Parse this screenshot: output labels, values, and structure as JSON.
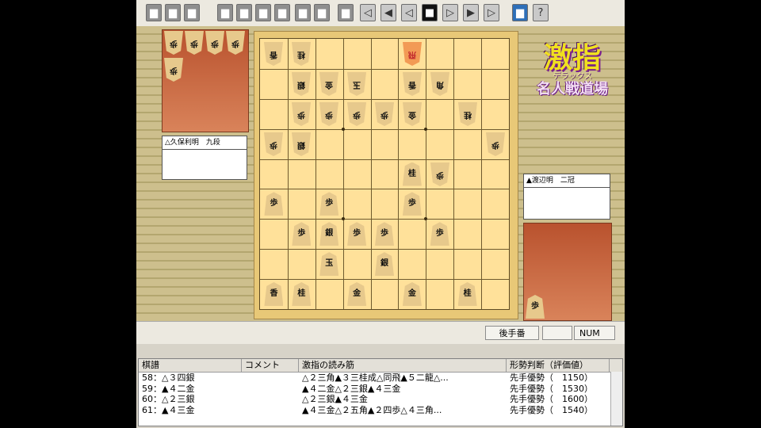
{
  "toolbar": {
    "buttons": [
      {
        "name": "new-icon",
        "glyph": "▆"
      },
      {
        "name": "open-icon",
        "glyph": "▆"
      },
      {
        "name": "save-icon",
        "glyph": "▆"
      },
      {
        "name": "copy-icon",
        "glyph": "▆"
      },
      {
        "name": "paste-icon",
        "glyph": "▆"
      },
      {
        "name": "print-icon",
        "glyph": "▆"
      },
      {
        "name": "edit-icon",
        "glyph": "▆"
      },
      {
        "name": "setup-icon",
        "glyph": "▆"
      },
      {
        "name": "think-icon",
        "glyph": "▆"
      },
      {
        "name": "hint-icon",
        "glyph": "▆"
      },
      {
        "name": "rewind-start-icon",
        "glyph": "◁"
      },
      {
        "name": "step-back-icon",
        "glyph": "◀"
      },
      {
        "name": "back-icon",
        "glyph": "◁"
      },
      {
        "name": "stop-icon",
        "glyph": "■"
      },
      {
        "name": "forward-icon",
        "glyph": "▷"
      },
      {
        "name": "step-forward-icon",
        "glyph": "▶"
      },
      {
        "name": "forward-end-icon",
        "glyph": "▷"
      },
      {
        "name": "display-icon",
        "glyph": "▆"
      },
      {
        "name": "help-icon",
        "glyph": "?"
      }
    ]
  },
  "logo": {
    "main": "激指",
    "sub1": "デラックス",
    "sub2": "名人戦道場"
  },
  "players": {
    "gote_name": "△久保利明　九段",
    "sente_name": "▲渡辺明　二冠"
  },
  "hand": {
    "gote": [
      "歩",
      "歩",
      "歩",
      "歩",
      "歩"
    ],
    "sente": [
      "歩"
    ]
  },
  "board": {
    "pieces": [
      {
        "f": 9,
        "r": 1,
        "t": "香",
        "o": "g"
      },
      {
        "f": 8,
        "r": 1,
        "t": "桂",
        "o": "g"
      },
      {
        "f": 4,
        "r": 1,
        "t": "飛",
        "o": "g",
        "hl": true
      },
      {
        "f": 8,
        "r": 2,
        "t": "銀",
        "o": "g"
      },
      {
        "f": 7,
        "r": 2,
        "t": "金",
        "o": "g"
      },
      {
        "f": 6,
        "r": 2,
        "t": "玉",
        "o": "g"
      },
      {
        "f": 4,
        "r": 2,
        "t": "香",
        "o": "g"
      },
      {
        "f": 3,
        "r": 2,
        "t": "角",
        "o": "g"
      },
      {
        "f": 8,
        "r": 3,
        "t": "歩",
        "o": "g"
      },
      {
        "f": 7,
        "r": 3,
        "t": "歩",
        "o": "g"
      },
      {
        "f": 6,
        "r": 3,
        "t": "歩",
        "o": "g"
      },
      {
        "f": 5,
        "r": 3,
        "t": "歩",
        "o": "g"
      },
      {
        "f": 4,
        "r": 3,
        "t": "金",
        "o": "g"
      },
      {
        "f": 2,
        "r": 3,
        "t": "桂",
        "o": "g"
      },
      {
        "f": 9,
        "r": 4,
        "t": "歩",
        "o": "g"
      },
      {
        "f": 8,
        "r": 4,
        "t": "銀",
        "o": "g"
      },
      {
        "f": 1,
        "r": 4,
        "t": "歩",
        "o": "g"
      },
      {
        "f": 4,
        "r": 5,
        "t": "桂",
        "o": "s"
      },
      {
        "f": 3,
        "r": 5,
        "t": "歩",
        "o": "g"
      },
      {
        "f": 9,
        "r": 6,
        "t": "歩",
        "o": "s"
      },
      {
        "f": 7,
        "r": 6,
        "t": "歩",
        "o": "s"
      },
      {
        "f": 4,
        "r": 6,
        "t": "歩",
        "o": "s"
      },
      {
        "f": 8,
        "r": 7,
        "t": "歩",
        "o": "s"
      },
      {
        "f": 7,
        "r": 7,
        "t": "銀",
        "o": "s"
      },
      {
        "f": 6,
        "r": 7,
        "t": "歩",
        "o": "s"
      },
      {
        "f": 5,
        "r": 7,
        "t": "歩",
        "o": "s"
      },
      {
        "f": 3,
        "r": 7,
        "t": "歩",
        "o": "s"
      },
      {
        "f": 7,
        "r": 8,
        "t": "玉",
        "o": "s"
      },
      {
        "f": 5,
        "r": 8,
        "t": "銀",
        "o": "s"
      },
      {
        "f": 9,
        "r": 9,
        "t": "香",
        "o": "s"
      },
      {
        "f": 8,
        "r": 9,
        "t": "桂",
        "o": "s"
      },
      {
        "f": 6,
        "r": 9,
        "t": "金",
        "o": "s"
      },
      {
        "f": 4,
        "r": 9,
        "t": "金",
        "o": "s"
      },
      {
        "f": 2,
        "r": 9,
        "t": "桂",
        "o": "s"
      }
    ]
  },
  "statusbar": {
    "turn": "後手番",
    "num": "NUM"
  },
  "kifu": {
    "headers": [
      "棋譜",
      "コメント",
      "激指の読み筋",
      "形勢判断（評価値）"
    ],
    "rows": [
      {
        "move": "58：△３四銀",
        "comment": "",
        "line": "△２三角▲３三桂成△同飛▲５二龍△...",
        "eval": "先手優勢（　1150）"
      },
      {
        "move": "59：▲４二金",
        "comment": "",
        "line": "▲４二金△２三銀▲４三金",
        "eval": "先手優勢（　1530）"
      },
      {
        "move": "60：△２三銀",
        "comment": "",
        "line": "△２三銀▲４三金",
        "eval": "先手優勢（　1600）"
      },
      {
        "move": "61：▲４三金",
        "comment": "",
        "line": "▲４三金△２五角▲２四歩△４三角...",
        "eval": "先手優勢（　1540）"
      }
    ]
  }
}
